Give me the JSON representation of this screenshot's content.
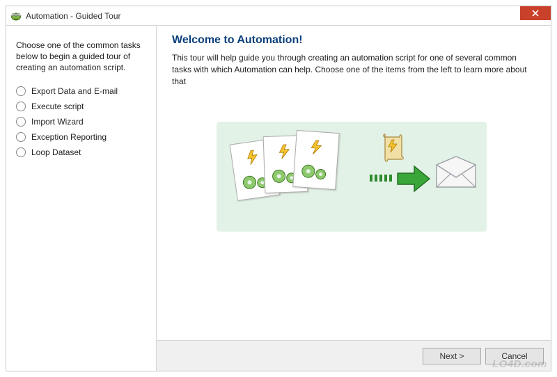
{
  "window": {
    "title": "Automation - Guided Tour",
    "close_label": "×"
  },
  "sidebar": {
    "description": "Choose one of the common tasks below to begin a guided tour of creating an automation script.",
    "options": [
      {
        "label": "Export Data and E-mail"
      },
      {
        "label": "Execute script"
      },
      {
        "label": "Import Wizard"
      },
      {
        "label": "Exception Reporting"
      },
      {
        "label": "Loop Dataset"
      }
    ]
  },
  "main": {
    "title": "Welcome to Automation!",
    "body": "This tour will help guide you through creating an automation script for one of several common tasks with which Automation can help. Choose one of the items from the left to learn more about that"
  },
  "footer": {
    "next_label": "Next >",
    "cancel_label": "Cancel"
  },
  "watermark": "LO4D.com"
}
